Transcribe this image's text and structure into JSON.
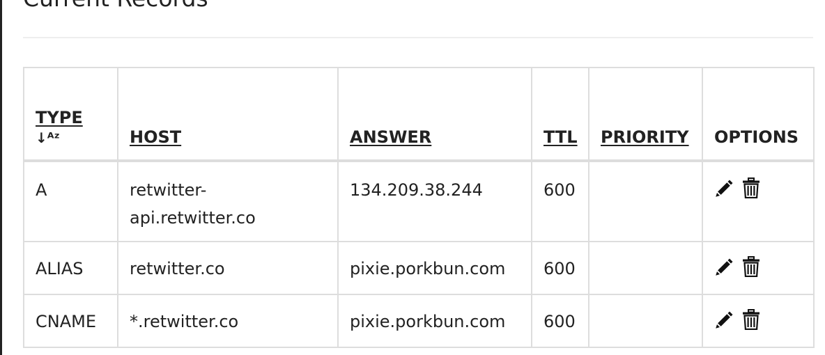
{
  "section": {
    "title": "Current Records"
  },
  "table": {
    "headers": {
      "type": "TYPE",
      "type_sort_icon": "↓ᴬᶻ",
      "host": "HOST",
      "answer": "ANSWER",
      "ttl": "TTL",
      "priority": "PRIORITY",
      "options": "OPTIONS"
    },
    "rows": [
      {
        "type": "A",
        "host": "retwitter-api.retwitter.co",
        "answer": "134.209.38.244",
        "ttl": "600",
        "priority": ""
      },
      {
        "type": "ALIAS",
        "host": "retwitter.co",
        "answer": "pixie.porkbun.com",
        "ttl": "600",
        "priority": ""
      },
      {
        "type": "CNAME",
        "host": "*.retwitter.co",
        "answer": "pixie.porkbun.com",
        "ttl": "600",
        "priority": ""
      }
    ],
    "row_icons": [
      "pencil-icon",
      "trash-icon"
    ]
  }
}
